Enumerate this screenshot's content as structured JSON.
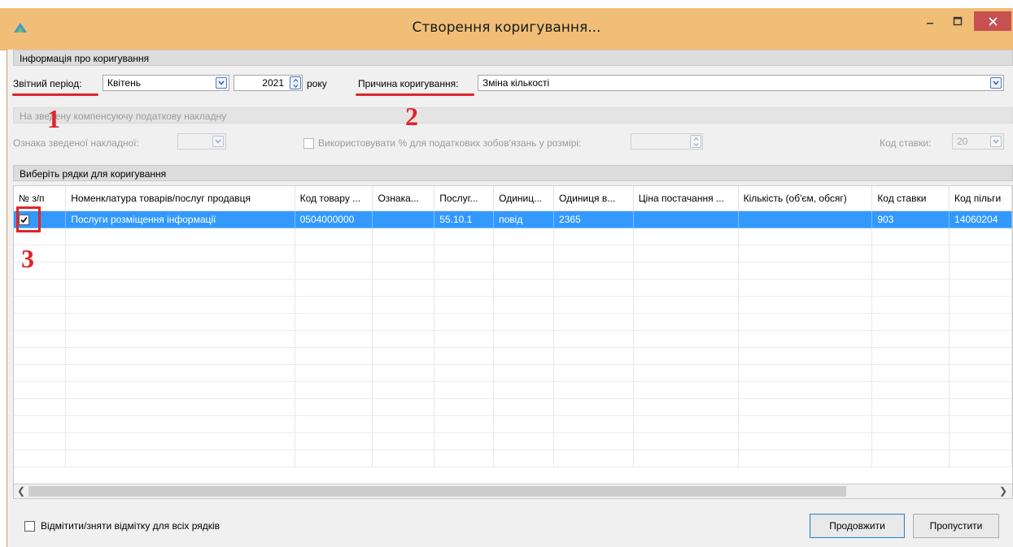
{
  "window": {
    "title": "Створення коригування..."
  },
  "info_header": "Інформація про коригування",
  "period": {
    "label": "Звітний період:",
    "month": "Квітень",
    "year": "2021",
    "year_suffix": "року"
  },
  "reason": {
    "label": "Причина коригування:",
    "value": "Зміна кількості"
  },
  "summary": {
    "header": "На зведену компенсуючу податкову накладну",
    "sign_label": "Ознака зведеної накладної:",
    "use_percent_label": "Використовувати % для податкових зобов'язань у розмірі:",
    "rate_code_label": "Код ставки:",
    "rate_code_value": "20"
  },
  "annotations": {
    "one": "1",
    "two": "2",
    "three": "3"
  },
  "grid": {
    "header": "Виберіть рядки для коригування",
    "columns": [
      "№ з/п",
      "Номенклатура товарів/послуг продавця",
      "Код товару ...",
      "Ознака...",
      "Послуг...",
      "Одиниц...",
      "Одиниця в...",
      "Ціна постачання ...",
      "Кількість (об'єм, обсяг)",
      "Код ставки",
      "Код пільги"
    ],
    "rows": [
      {
        "cells": [
          "",
          "Послуги розміщення інформації",
          "0504000000",
          "",
          "55.10.1",
          "повід",
          "2365",
          "",
          "",
          "903",
          "14060204"
        ],
        "checked": true
      }
    ]
  },
  "footer": {
    "toggle_all_label": "Відмітити/зняти відмітку для всіх рядків",
    "continue_label": "Продовжити",
    "skip_label": "Пропустити"
  },
  "colors": {
    "title_bar": "#f1be78",
    "selection": "#3399ff",
    "annotation": "#e0242a",
    "close": "#c75050"
  }
}
